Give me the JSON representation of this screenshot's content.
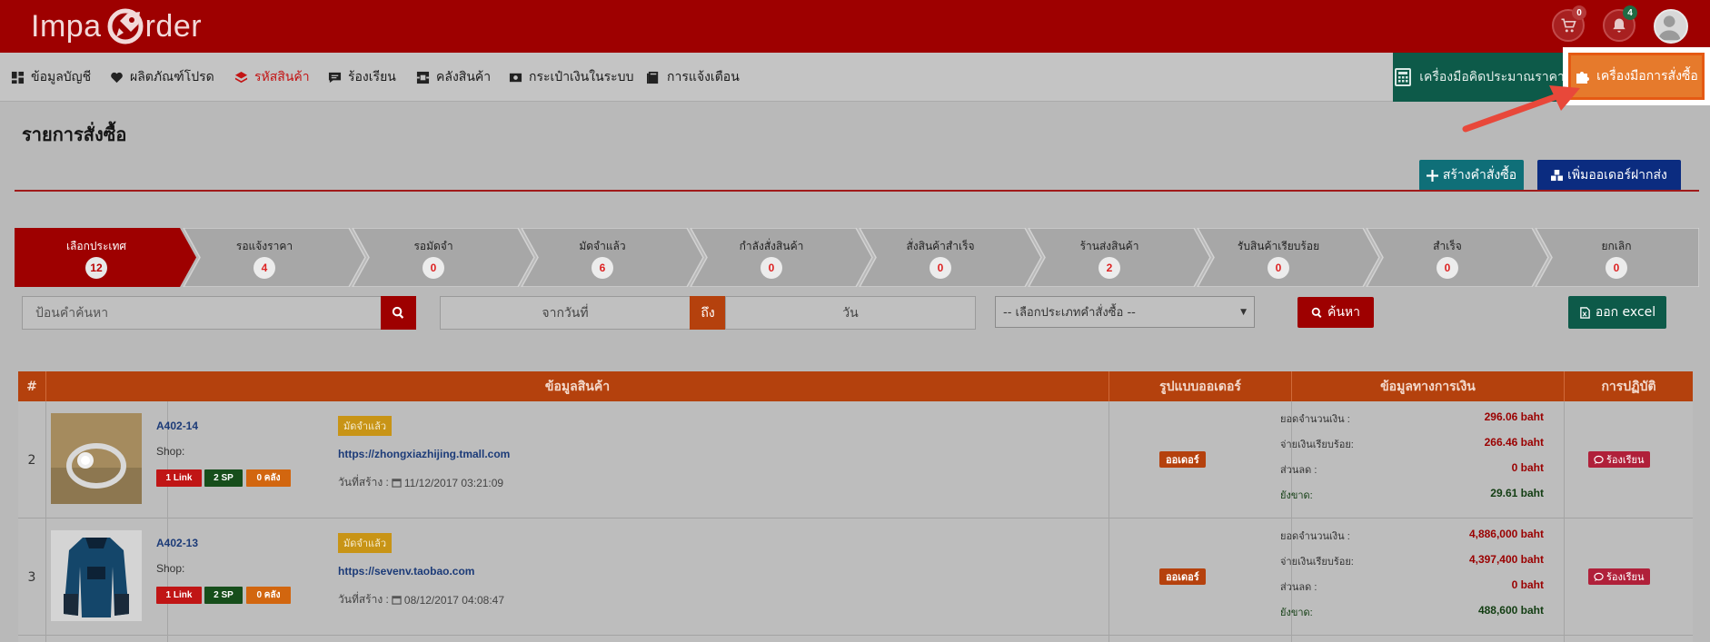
{
  "brand": {
    "logo_left": "Impa",
    "logo_right": "rder"
  },
  "header": {
    "cart_count": "0",
    "notify_count": "4"
  },
  "nav": {
    "items": [
      {
        "label": "ข้อมูลบัญชี",
        "icon": "dashboard-icon"
      },
      {
        "label": "ผลิตภัณฑ์โปรด",
        "icon": "heart-icon"
      },
      {
        "label": "รหัสสินค้า",
        "icon": "layers-icon",
        "active": true
      },
      {
        "label": "ร้องเรียน",
        "icon": "comment-icon"
      },
      {
        "label": "คลังสินค้า",
        "icon": "warehouse-icon"
      },
      {
        "label": "กระเป๋าเงินในระบบ",
        "icon": "wallet-icon"
      },
      {
        "label": "การแจ้งเตือน",
        "icon": "book-icon"
      }
    ],
    "calc_tool": "เครื่องมือคิดประมาณราคา",
    "order_tool": "เครื่องมือการสั่งซื้อ"
  },
  "page": {
    "title": "รายการสั่งซื้อ",
    "create_order": "สร้างคำสั่งซื้อ",
    "add_forward_order": "เพิ่มออเดอร์ฝากส่ง"
  },
  "steps": [
    {
      "label": "เลือกประเทศ",
      "count": "12"
    },
    {
      "label": "รอแจ้งราคา",
      "count": "4"
    },
    {
      "label": "รอมัดจำ",
      "count": "0"
    },
    {
      "label": "มัดจำแล้ว",
      "count": "6"
    },
    {
      "label": "กำลังสั่งสินค้า",
      "count": "0"
    },
    {
      "label": "สั่งสินค้าสำเร็จ",
      "count": "0"
    },
    {
      "label": "ร้านส่งสินค้า",
      "count": "2"
    },
    {
      "label": "รับสินค้าเรียบร้อย",
      "count": "0"
    },
    {
      "label": "สำเร็จ",
      "count": "0"
    },
    {
      "label": "ยกเลิก",
      "count": "0"
    }
  ],
  "filters": {
    "search_placeholder": "ป้อนคำค้นหา",
    "date_from": "จากวันที่",
    "date_to_label": "ถึง",
    "date_to": "วัน",
    "order_type_select": "-- เลือกประเภทคำสั่งซื้อ --",
    "search_button": "ค้นหา",
    "excel_button": "ออก excel"
  },
  "table": {
    "headers": [
      "#",
      "ข้อมูลสินค้า",
      "รูปแบบออเดอร์",
      "ข้อมูลทางการเงิน",
      "การปฏิบัติ"
    ],
    "rows": [
      {
        "num": "2",
        "order_id": "A402-14",
        "shop_label": "Shop:",
        "tag_link": "1 Link",
        "tag_sp": "2 SP",
        "tag_stock": "0 คลัง",
        "status": "มัดจำแล้ว",
        "shop_url": "https://zhongxiazhijing.tmall.com",
        "created_label": "วันที่สร้าง :",
        "created": "11/12/2017 03:21:09",
        "order_type": "ออเดอร์",
        "fin_total_label": "ยอดจำนวนเงิน :",
        "fin_total": "296.06 baht",
        "fin_paid_label": "จ่ายเงินเรียบร้อย:",
        "fin_paid": "266.46 baht",
        "fin_discount_label": "ส่วนลด :",
        "fin_discount": "0 baht",
        "fin_due_label": "ยังขาด:",
        "fin_due": "29.61 baht",
        "action": "ร้องเรียน"
      },
      {
        "num": "3",
        "order_id": "A402-13",
        "shop_label": "Shop:",
        "tag_link": "1 Link",
        "tag_sp": "2 SP",
        "tag_stock": "0 คลัง",
        "status": "มัดจำแล้ว",
        "shop_url": "https://sevenv.taobao.com",
        "created_label": "วันที่สร้าง :",
        "created": "08/12/2017 04:08:47",
        "order_type": "ออเดอร์",
        "fin_total_label": "ยอดจำนวนเงิน :",
        "fin_total": "4,886,000 baht",
        "fin_paid_label": "จ่ายเงินเรียบร้อย:",
        "fin_paid": "4,397,400 baht",
        "fin_discount_label": "ส่วนลด :",
        "fin_discount": "0 baht",
        "fin_due_label": "ยังขาด:",
        "fin_due": "488,600 baht",
        "action": "ร้องเรียน"
      }
    ]
  },
  "colors": {
    "brand_red": "#9e0000",
    "accent_orange": "#e67a2c",
    "green": "#0d5a49",
    "table_header": "#b4410d"
  }
}
